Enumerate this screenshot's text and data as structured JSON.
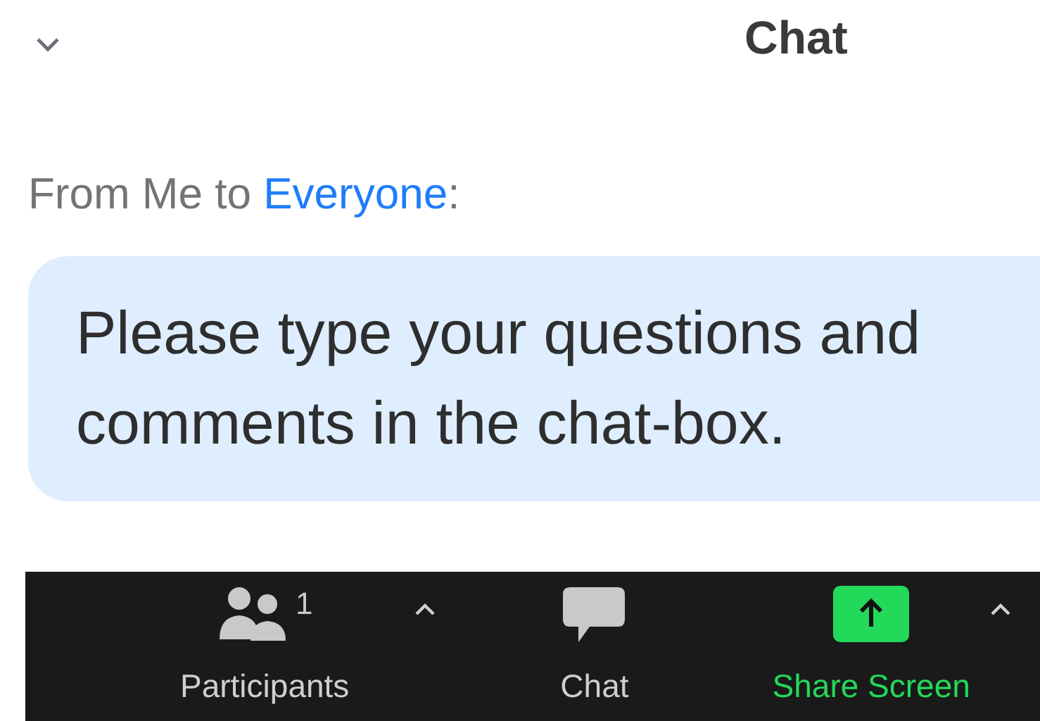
{
  "header": {
    "title": "Chat"
  },
  "message": {
    "from_prefix": "From Me to ",
    "recipient": "Everyone",
    "from_suffix": ":",
    "text": "Please type your questions and comments in the chat-box."
  },
  "toolbar": [
    {
      "kind": "participants",
      "label": "Participants",
      "count": "1",
      "menu": true,
      "highlighted": false
    },
    {
      "kind": "chat",
      "label": "Chat",
      "menu": false,
      "highlighted": false
    },
    {
      "kind": "share",
      "label": "Share Screen",
      "menu": true,
      "highlighted": true
    }
  ]
}
